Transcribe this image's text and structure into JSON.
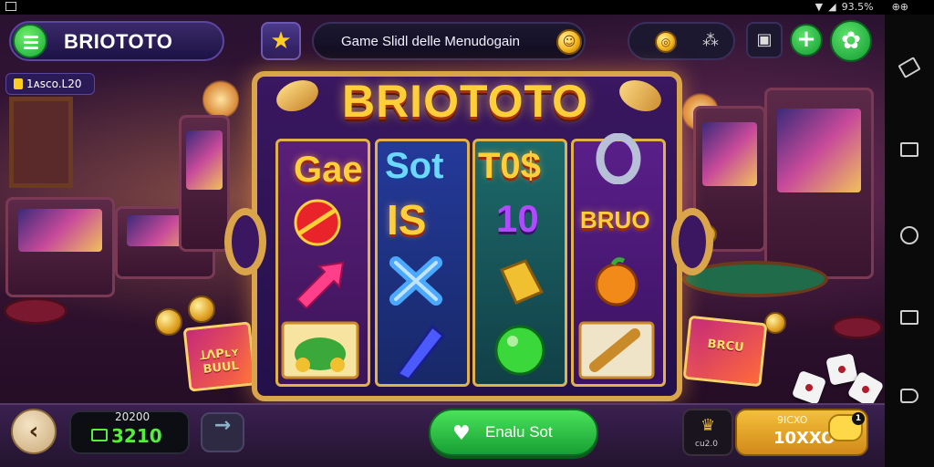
{
  "status_bar": {
    "battery": "93.5%",
    "right_label": "⊕⊕"
  },
  "header": {
    "brand": "BRIOTOTO",
    "search_text": "Game Slidl delle Menudogain",
    "badge_text": "1ᴀsco.L20"
  },
  "machine": {
    "title": "BRIOTOTO",
    "reel_labels": [
      "Gae",
      "Sot",
      "T0$",
      "IS",
      "10",
      "BRUO"
    ]
  },
  "bottom": {
    "score_top": "20200",
    "score_main": "3210",
    "spin_label": "Enalu Sot",
    "bet_value": "ᴄu2.0",
    "win_top": "9ICXO",
    "win_main": "10XXO",
    "chat_badge": "1"
  },
  "decor": {
    "left_gift_text": "ꞱɅPʟʏ BUUL",
    "right_gift_text": "BRCU"
  },
  "colors": {
    "accent_green": "#17a034",
    "gold": "#ffcf3a",
    "purple_bg": "#2a1231"
  }
}
